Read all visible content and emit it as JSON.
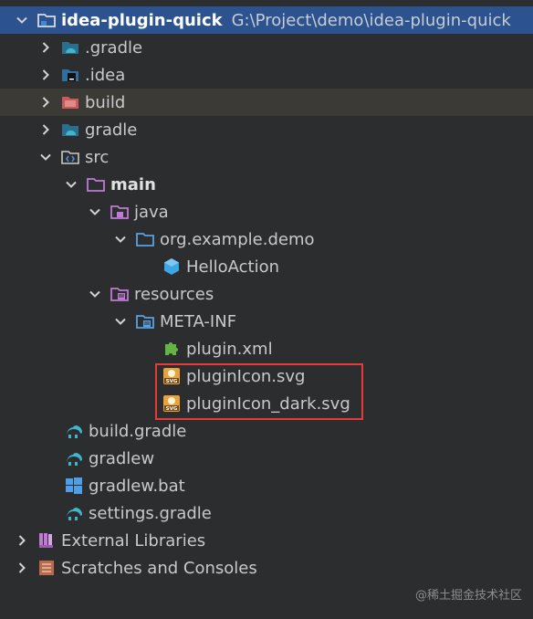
{
  "project": {
    "name": "idea-plugin-quick",
    "path": "G:\\Project\\demo\\idea-plugin-quick"
  },
  "nodes": [
    {
      "label": ".gradle",
      "icon": "folder-gradle-icon"
    },
    {
      "label": ".idea",
      "icon": "folder-idea-icon"
    },
    {
      "label": "build",
      "icon": "folder-excluded-icon"
    },
    {
      "label": "gradle",
      "icon": "folder-gradle-icon"
    },
    {
      "label": "src",
      "icon": "folder-source-icon"
    },
    {
      "label": "main",
      "icon": "folder-icon"
    },
    {
      "label": "java",
      "icon": "folder-java-icon"
    },
    {
      "label": "org.example.demo",
      "icon": "package-icon"
    },
    {
      "label": "HelloAction",
      "icon": "class-icon"
    },
    {
      "label": "resources",
      "icon": "folder-resources-icon"
    },
    {
      "label": "META-INF",
      "icon": "folder-resources-icon"
    },
    {
      "label": "plugin.xml",
      "icon": "plugin-xml-icon"
    },
    {
      "label": "pluginIcon.svg",
      "icon": "svg-file-icon"
    },
    {
      "label": "pluginIcon_dark.svg",
      "icon": "svg-file-icon"
    },
    {
      "label": "build.gradle",
      "icon": "gradle-file-icon"
    },
    {
      "label": "gradlew",
      "icon": "gradle-file-icon"
    },
    {
      "label": "gradlew.bat",
      "icon": "windows-icon"
    },
    {
      "label": "settings.gradle",
      "icon": "gradle-file-icon"
    },
    {
      "label": "External Libraries",
      "icon": "libraries-icon"
    },
    {
      "label": "Scratches and Consoles",
      "icon": "scratches-icon"
    }
  ],
  "watermark": "@稀土掘金技术社区",
  "colors": {
    "selection": "#2c5390",
    "excluded_bg": "#3b3a34",
    "highlight_border": "#e63b3b"
  }
}
